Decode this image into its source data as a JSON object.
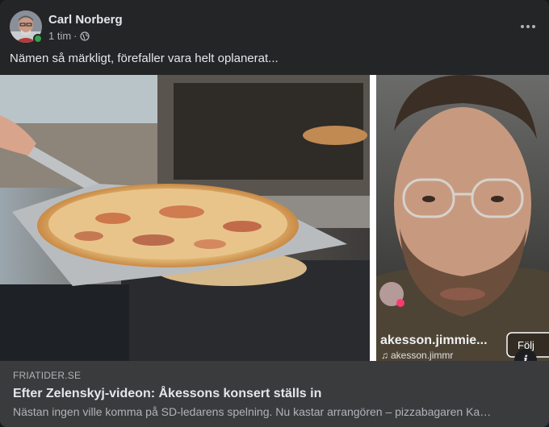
{
  "post": {
    "author": "Carl Norberg",
    "time": "1 tim",
    "separator": "·",
    "privacy_icon": "globe-icon",
    "text": "Nämen så märkligt, förefaller vara helt oplanerat...",
    "more_icon": "more-horizontal-icon",
    "online_color": "#31a24c"
  },
  "media": {
    "overlay": {
      "username": "akesson.jimmie...",
      "sub": "akesson.jimmr",
      "audio_icon": "music-note-icon",
      "follow_label": "Följ",
      "live_badge_icon": "heart-icon"
    },
    "info_icon": "info-icon",
    "info_label": "i"
  },
  "link": {
    "domain": "FRIATIDER.SE",
    "title": "Efter Zelenskyj-videon: Åkessons konsert ställs in",
    "description": "Nästan ingen ville komma på SD-ledarens spelning. Nu kastar arrangören – pizzabagaren Ka…"
  }
}
